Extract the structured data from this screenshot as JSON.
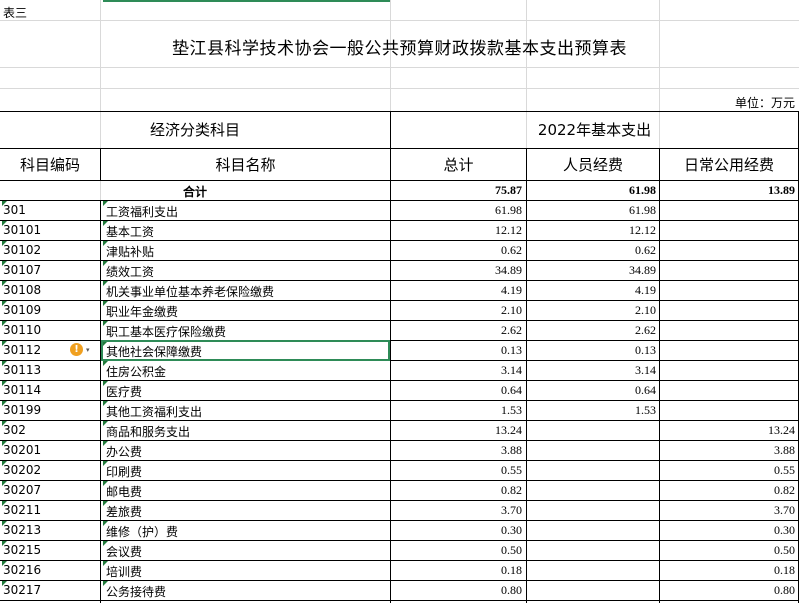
{
  "sheet_label": "表三",
  "title": "垫江县科学技术协会一般公共预算财政拨款基本支出预算表",
  "unit": "单位：万元",
  "headers": {
    "category": "经济分类科目",
    "year_expense": "2022年基本支出",
    "code": "科目编码",
    "name": "科目名称",
    "total": "总计",
    "personnel": "人员经费",
    "public": "日常公用经费"
  },
  "total_row": {
    "label": "合计",
    "total": "75.87",
    "personnel": "61.98",
    "public": "13.89"
  },
  "rows": [
    {
      "code": "301",
      "name": "工资福利支出",
      "total": "61.98",
      "personnel": "61.98",
      "public": ""
    },
    {
      "code": "30101",
      "name": "基本工资",
      "total": "12.12",
      "personnel": "12.12",
      "public": ""
    },
    {
      "code": "30102",
      "name": "津贴补贴",
      "total": "0.62",
      "personnel": "0.62",
      "public": ""
    },
    {
      "code": "30107",
      "name": "绩效工资",
      "total": "34.89",
      "personnel": "34.89",
      "public": ""
    },
    {
      "code": "30108",
      "name": "机关事业单位基本养老保险缴费",
      "total": "4.19",
      "personnel": "4.19",
      "public": ""
    },
    {
      "code": "30109",
      "name": "职业年金缴费",
      "total": "2.10",
      "personnel": "2.10",
      "public": ""
    },
    {
      "code": "30110",
      "name": "职工基本医疗保险缴费",
      "total": "2.62",
      "personnel": "2.62",
      "public": ""
    },
    {
      "code": "30112",
      "name": "其他社会保障缴费",
      "total": "0.13",
      "personnel": "0.13",
      "public": ""
    },
    {
      "code": "30113",
      "name": "住房公积金",
      "total": "3.14",
      "personnel": "3.14",
      "public": ""
    },
    {
      "code": "30114",
      "name": "医疗费",
      "total": "0.64",
      "personnel": "0.64",
      "public": ""
    },
    {
      "code": "30199",
      "name": "其他工资福利支出",
      "total": "1.53",
      "personnel": "1.53",
      "public": ""
    },
    {
      "code": "302",
      "name": "商品和服务支出",
      "total": "13.24",
      "personnel": "",
      "public": "13.24"
    },
    {
      "code": "30201",
      "name": "办公费",
      "total": "3.88",
      "personnel": "",
      "public": "3.88"
    },
    {
      "code": "30202",
      "name": "印刷费",
      "total": "0.55",
      "personnel": "",
      "public": "0.55"
    },
    {
      "code": "30207",
      "name": "邮电费",
      "total": "0.82",
      "personnel": "",
      "public": "0.82"
    },
    {
      "code": "30211",
      "name": "差旅费",
      "total": "3.70",
      "personnel": "",
      "public": "3.70"
    },
    {
      "code": "30213",
      "name": "维修（护）费",
      "total": "0.30",
      "personnel": "",
      "public": "0.30"
    },
    {
      "code": "30215",
      "name": "会议费",
      "total": "0.50",
      "personnel": "",
      "public": "0.50"
    },
    {
      "code": "30216",
      "name": "培训费",
      "total": "0.18",
      "personnel": "",
      "public": "0.18"
    },
    {
      "code": "30217",
      "name": "公务接待费",
      "total": "0.80",
      "personnel": "",
      "public": "0.80"
    }
  ],
  "icons": {
    "warning": "warning-icon",
    "dropdown": "dropdown-arrow-icon"
  },
  "colors": {
    "selection": "#2e8b57",
    "warning": "#f0a020",
    "error_marker": "#1f7a3a"
  }
}
